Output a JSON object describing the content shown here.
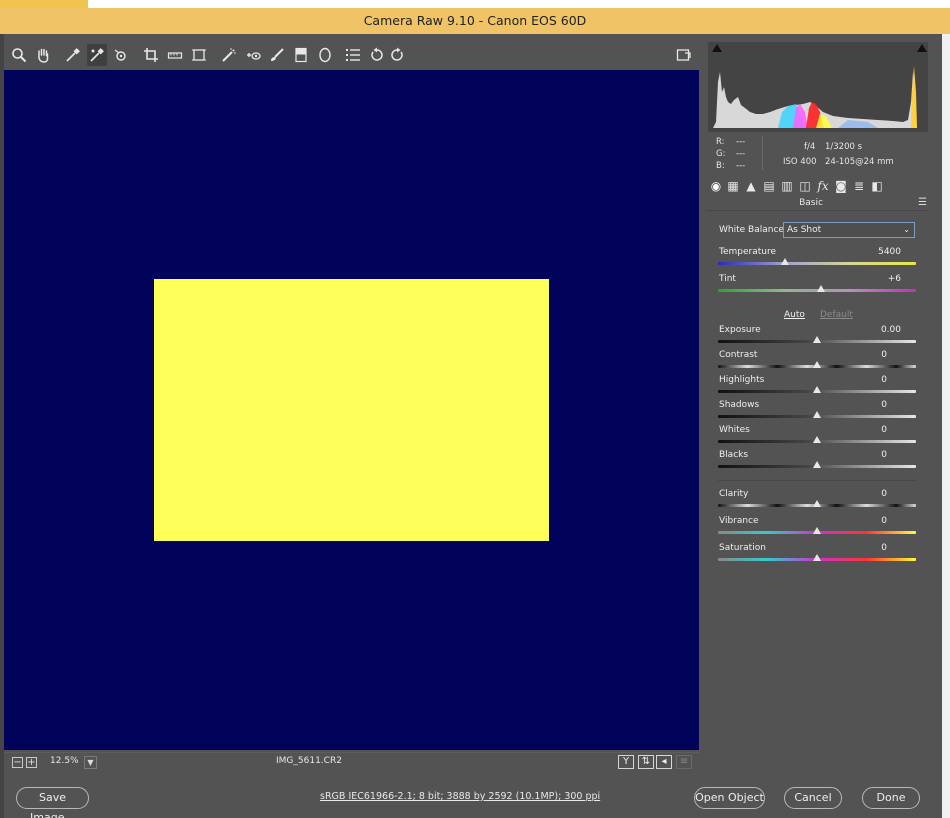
{
  "window": {
    "title": "Camera Raw 9.10  -  Canon EOS 60D"
  },
  "toolbar": {
    "tools": [
      "zoom-icon",
      "hand-icon",
      "white-balance-icon",
      "color-sampler-icon",
      "targeted-adjustment-icon",
      "crop-icon",
      "straighten-icon",
      "transform-icon",
      "spot-removal-icon",
      "red-eye-icon",
      "adjustment-brush-icon",
      "graduated-filter-icon",
      "radial-filter-icon",
      "preferences-icon",
      "rotate-left-icon",
      "rotate-right-icon"
    ],
    "fullscreen_icon": "fullscreen-icon"
  },
  "preview": {
    "background_color": "#000359",
    "image_color": "#ffff5a"
  },
  "statusbar": {
    "zoom_out": "−",
    "zoom_in": "+",
    "zoom_level": "12.5%",
    "filename": "IMG_5611.CR2",
    "view_before_after": "Y"
  },
  "readout": {
    "r_label": "R:",
    "r_value": "---",
    "g_label": "G:",
    "g_value": "---",
    "b_label": "B:",
    "b_value": "---",
    "aperture": "f/4",
    "shutter": "1/3200 s",
    "iso": "ISO 400",
    "lens": "24-105@24 mm"
  },
  "panel": {
    "title": "Basic",
    "white_balance_label": "White Balance:",
    "white_balance_value": "As Shot",
    "auto_label": "Auto",
    "default_label": "Default",
    "sliders": [
      {
        "key": "temperature",
        "label": "Temperature",
        "value": "5400",
        "position": 0.34
      },
      {
        "key": "tint",
        "label": "Tint",
        "value": "+6",
        "position": 0.52
      },
      {
        "key": "exposure",
        "label": "Exposure",
        "value": "0.00",
        "position": 0.5
      },
      {
        "key": "contrast",
        "label": "Contrast",
        "value": "0",
        "position": 0.5
      },
      {
        "key": "highlights",
        "label": "Highlights",
        "value": "0",
        "position": 0.5
      },
      {
        "key": "shadows",
        "label": "Shadows",
        "value": "0",
        "position": 0.5
      },
      {
        "key": "whites",
        "label": "Whites",
        "value": "0",
        "position": 0.5
      },
      {
        "key": "blacks",
        "label": "Blacks",
        "value": "0",
        "position": 0.5
      },
      {
        "key": "clarity",
        "label": "Clarity",
        "value": "0",
        "position": 0.5
      },
      {
        "key": "vibrance",
        "label": "Vibrance",
        "value": "0",
        "position": 0.5
      },
      {
        "key": "saturation",
        "label": "Saturation",
        "value": "0",
        "position": 0.5
      }
    ]
  },
  "footer": {
    "save_label": "Save Image...",
    "workflow_text": "sRGB IEC61966-2.1; 8 bit; 3888 by 2592 (10.1MP); 300 ppi",
    "open_label": "Open Object",
    "cancel_label": "Cancel",
    "done_label": "Done"
  }
}
